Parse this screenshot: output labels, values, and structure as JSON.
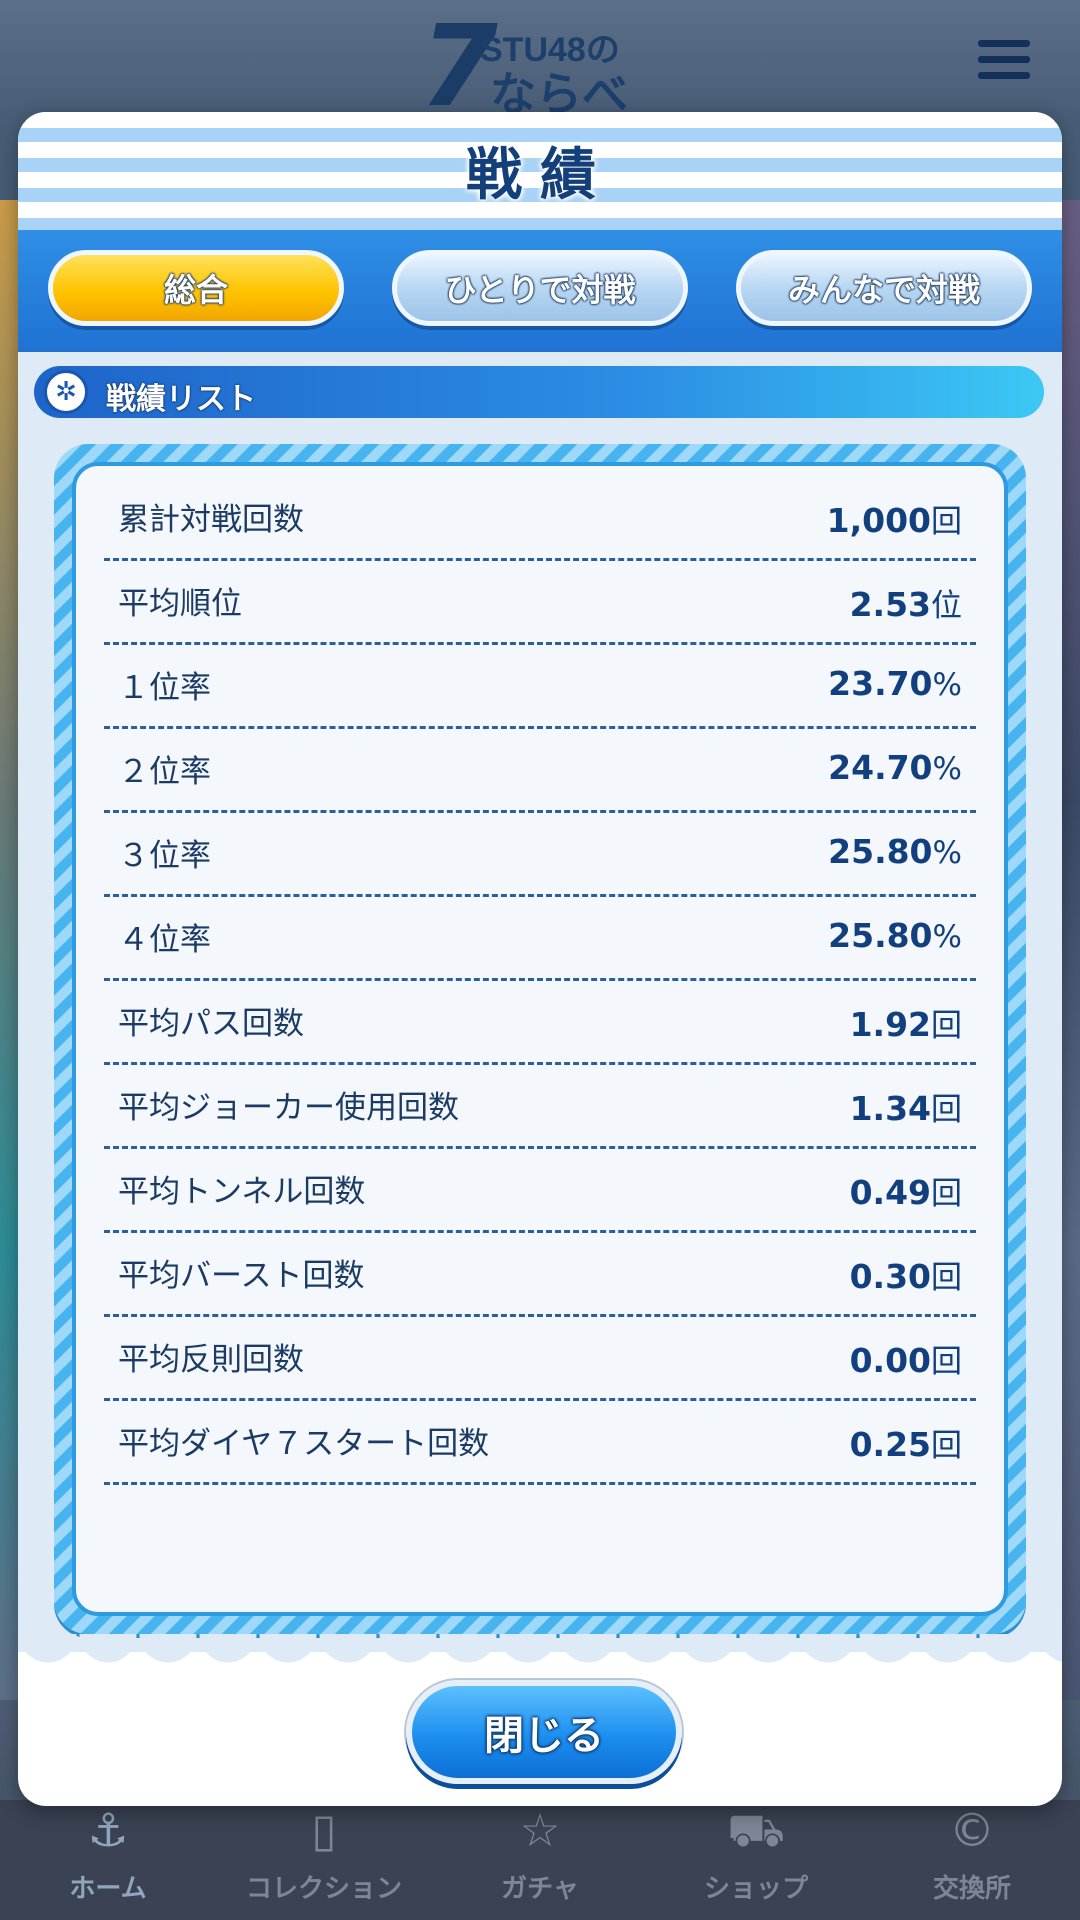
{
  "header": {
    "logo_number": "7",
    "logo_brand": "STU48の",
    "logo_sub": "ならべ"
  },
  "modal": {
    "title": "戦績",
    "tabs": [
      {
        "label": "総合",
        "active": true
      },
      {
        "label": "ひとりで対戦",
        "active": false
      },
      {
        "label": "みんなで対戦",
        "active": false
      }
    ],
    "section_label": "戦績リスト",
    "stats": [
      {
        "label": "累計対戦回数",
        "value": "1,000",
        "unit": "回"
      },
      {
        "label": "平均順位",
        "value": "2.53",
        "unit": "位"
      },
      {
        "label": "１位率",
        "value": "23.70",
        "unit": "%"
      },
      {
        "label": "２位率",
        "value": "24.70",
        "unit": "%"
      },
      {
        "label": "３位率",
        "value": "25.80",
        "unit": "%"
      },
      {
        "label": "４位率",
        "value": "25.80",
        "unit": "%"
      },
      {
        "label": "平均パス回数",
        "value": "1.92",
        "unit": "回"
      },
      {
        "label": "平均ジョーカー使用回数",
        "value": "1.34",
        "unit": "回"
      },
      {
        "label": "平均トンネル回数",
        "value": "0.49",
        "unit": "回"
      },
      {
        "label": "平均バースト回数",
        "value": "0.30",
        "unit": "回"
      },
      {
        "label": "平均反則回数",
        "value": "0.00",
        "unit": "回"
      },
      {
        "label": "平均ダイヤ７スタート回数",
        "value": "0.25",
        "unit": "回"
      }
    ],
    "close_label": "閉じる"
  },
  "bottom_nav": [
    {
      "label": "ホーム",
      "icon": "anchor-icon"
    },
    {
      "label": "コレクション",
      "icon": "cards-icon"
    },
    {
      "label": "ガチャ",
      "icon": "star-box-icon"
    },
    {
      "label": "ショップ",
      "icon": "cart-icon"
    },
    {
      "label": "交換所",
      "icon": "coin-exchange-icon"
    }
  ],
  "colors": {
    "title": "#13407a",
    "tab_active": "#ffc400",
    "tab_bar": "#1f72d2",
    "value_text": "#123f7e",
    "close_button": "#1c8ef0"
  }
}
